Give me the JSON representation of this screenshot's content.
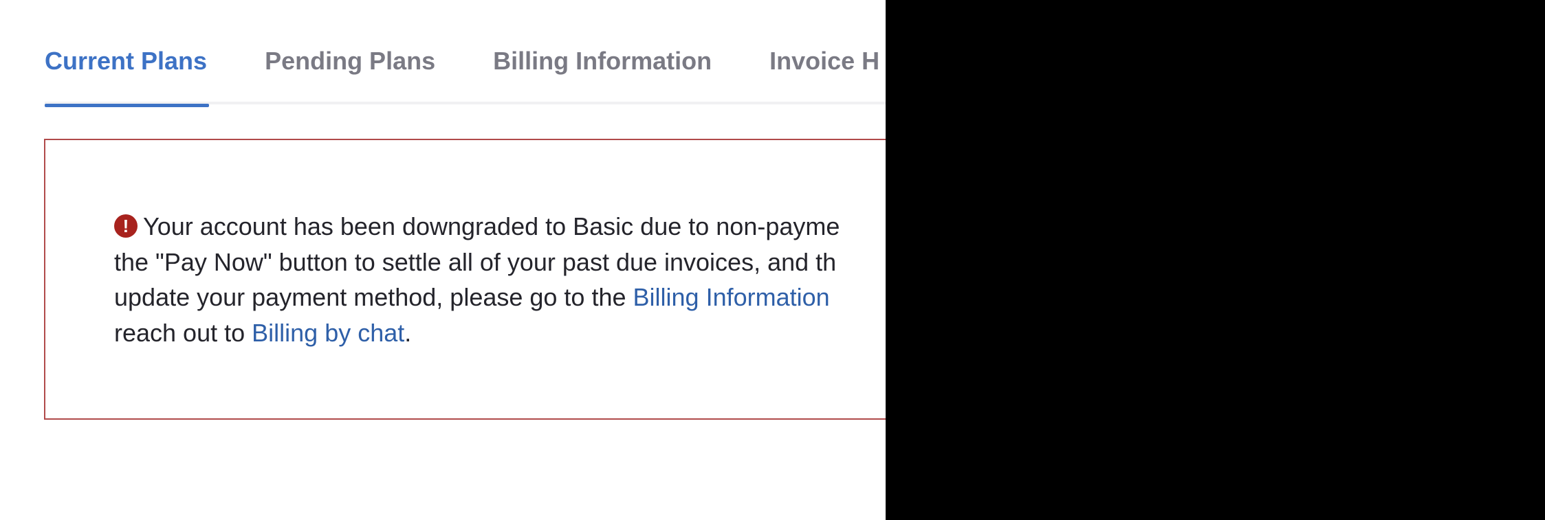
{
  "tabs": [
    {
      "label": "Current Plans",
      "active": true
    },
    {
      "label": "Pending Plans",
      "active": false
    },
    {
      "label": "Billing Information",
      "active": false
    },
    {
      "label": "Invoice H",
      "active": false
    }
  ],
  "alert": {
    "icon": "exclamation-circle-icon",
    "line1": "Your account has been downgraded to Basic due to non-payme",
    "line2": "the \"Pay Now\" button to settle all of your past due invoices, and th",
    "line3_before": "update your payment method, please go to the ",
    "line3_link": "Billing Information",
    "line4_before": "reach out to ",
    "line4_link": "Billing by chat",
    "line4_after": "."
  },
  "colors": {
    "accent": "#3d72c5",
    "inactive_tab": "#7a7a84",
    "alert_border": "#b04a4a",
    "alert_icon": "#a8231e",
    "link": "#2e5fa8"
  }
}
